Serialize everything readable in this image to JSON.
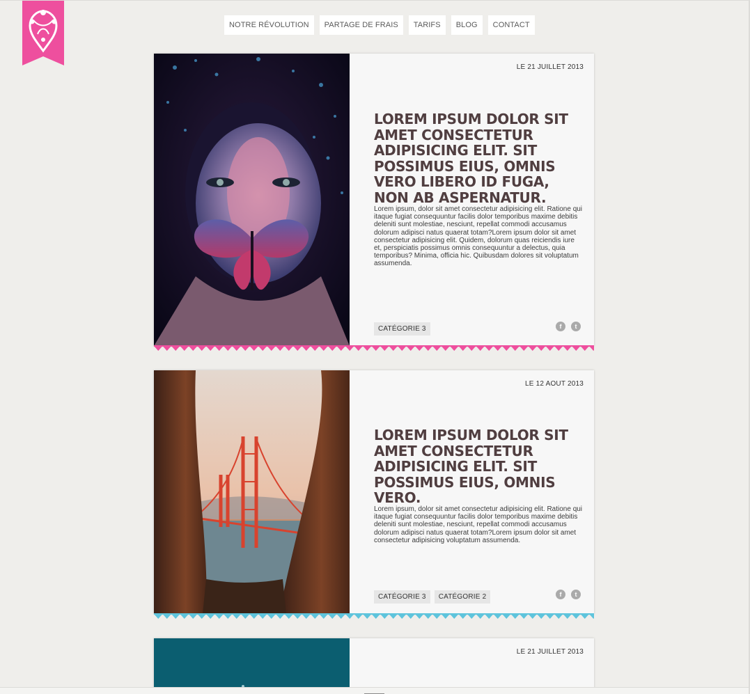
{
  "nav": {
    "items": [
      "NOTRE RÉVOLUTION",
      "PARTAGE DE FRAIS",
      "TARIFS",
      "BLOG",
      "CONTACT"
    ]
  },
  "brand": {
    "accent": "#ee4f9e",
    "teal": "#5ec4dc",
    "title_color": "#503e40"
  },
  "posts": [
    {
      "date": "LE 21 JUILLET 2013",
      "title": "LOREM IPSUM DOLOR SIT AMET CONSECTETUR ADIPISICING ELIT. SIT POSSIMUS EIUS, OMNIS VERO LIBERO ID FUGA, NON AB ASPERNATUR.",
      "excerpt": "Lorem ipsum, dolor sit amet consectetur adipisicing elit. Ratione qui itaque fugiat consequuntur facilis dolor temporibus maxime debitis deleniti sunt molestiae, nesciunt, repellat commodi accusamus dolorum adipisci natus quaerat totam?Lorem ipsum dolor sit amet consectetur adipisicing elit. Quidem, dolorum quas reiciendis iure et, perspiciatis possimus omnis consequuntur a delectus, quia temporibus? Minima, officia hic. Quibusdam dolores sit voluptatum assumenda.",
      "tags": [
        "CATÉGORIE 3"
      ],
      "border_color": "#ee4f9e"
    },
    {
      "date": "LE 12 AOUT 2013",
      "title": "LOREM IPSUM DOLOR SIT AMET CONSECTETUR ADIPISICING ELIT. SIT POSSIMUS EIUS, OMNIS VERO.",
      "excerpt": "Lorem ipsum, dolor sit amet consectetur adipisicing elit. Ratione qui itaque fugiat consequuntur facilis dolor temporibus maxime debitis deleniti sunt molestiae, nesciunt, repellat commodi accusamus dolorum adipisci natus quaerat totam?Lorem ipsum dolor sit amet consectetur adipisicing voluptatum assumenda.",
      "tags": [
        "CATÉGORIE 3",
        "CATÉGORIE 2"
      ],
      "border_color": "#5ec4dc"
    },
    {
      "date": "LE 21 JUILLET 2013"
    }
  ],
  "social": {
    "facebook": "f",
    "twitter": "t"
  }
}
